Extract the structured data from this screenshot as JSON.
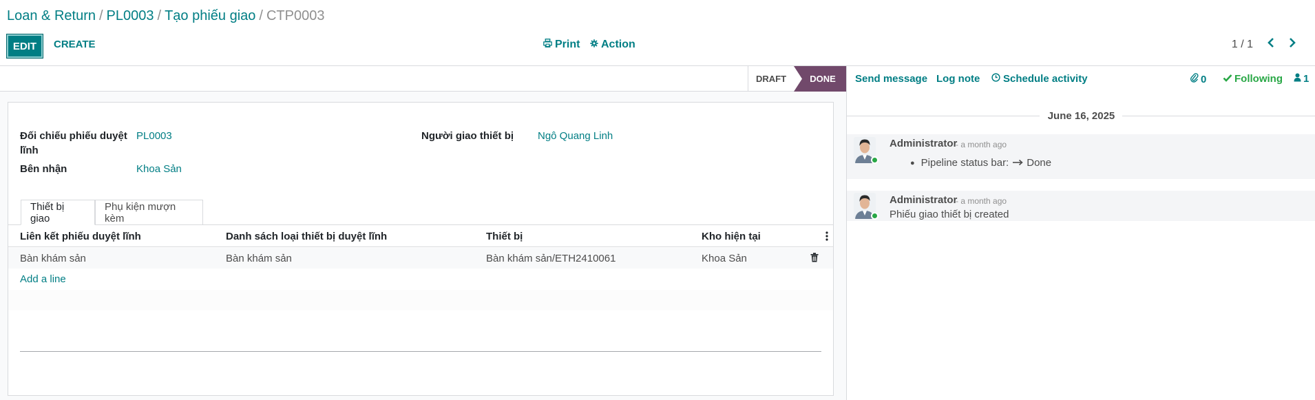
{
  "breadcrumb": {
    "items": [
      "Loan & Return",
      "PL0003",
      "Tạo phiếu giao"
    ],
    "current": "CTP0003",
    "separator": "/"
  },
  "toolbar": {
    "edit_label": "EDIT",
    "create_label": "CREATE",
    "print_label": "Print",
    "action_label": "Action"
  },
  "pager": {
    "value": "1 / 1"
  },
  "statusbar": {
    "stages": [
      "DRAFT",
      "DONE"
    ],
    "active_stage": "DONE",
    "active_color": "#71496b"
  },
  "form": {
    "fields": {
      "doi_chieu_label_line1": "Đối chiếu phiếu duyệt",
      "doi_chieu_label_line2": "lĩnh",
      "doi_chieu_value": "PL0003",
      "ben_nhan_label": "Bên nhận",
      "ben_nhan_value": "Khoa Sản",
      "nguoi_giao_label": "Người giao thiết bị",
      "nguoi_giao_value": "Ngô Quang Linh"
    },
    "tabs": [
      {
        "label": "Thiết bị giao",
        "active": true
      },
      {
        "label": "Phụ kiện mượn kèm",
        "active": false
      }
    ],
    "table": {
      "columns": [
        "Liên kết phiếu duyệt lĩnh",
        "Danh sách loại thiết bị duyệt lĩnh",
        "Thiết bị",
        "Kho hiện tại"
      ],
      "rows": [
        [
          "Bàn khám sản",
          "Bàn khám sản",
          "Bàn khám sản/ETH2410061",
          "Khoa Sản"
        ]
      ],
      "add_line_label": "Add a line"
    }
  },
  "chatter": {
    "send_message_label": "Send message",
    "log_note_label": "Log note",
    "schedule_activity_label": "Schedule activity",
    "attachments_count": "0",
    "following_label": "Following",
    "followers_count": "1",
    "date_separator": "June 16, 2025",
    "messages": [
      {
        "author": "Administrator",
        "time": "- a month ago",
        "tracking_text": "Pipeline status bar:",
        "tracking_value": "Done"
      },
      {
        "author": "Administrator",
        "time": "- a month ago",
        "body": "Phiếu giao thiết bị created"
      }
    ]
  },
  "icons": {
    "print": "printer-icon",
    "action": "gear-icon",
    "pager_prev": "chevron-left-icon",
    "pager_next": "chevron-right-icon",
    "schedule": "clock-icon",
    "attachment": "paperclip-icon",
    "following": "check-icon",
    "followers": "user-icon",
    "delete_row": "trash-icon",
    "column_options": "kebab-icon",
    "tracking_arrow": "arrow-right-icon"
  },
  "colors": {
    "primary": "#017e84",
    "done_stage": "#71496b",
    "following": "#28a745",
    "online": "#28a745"
  }
}
